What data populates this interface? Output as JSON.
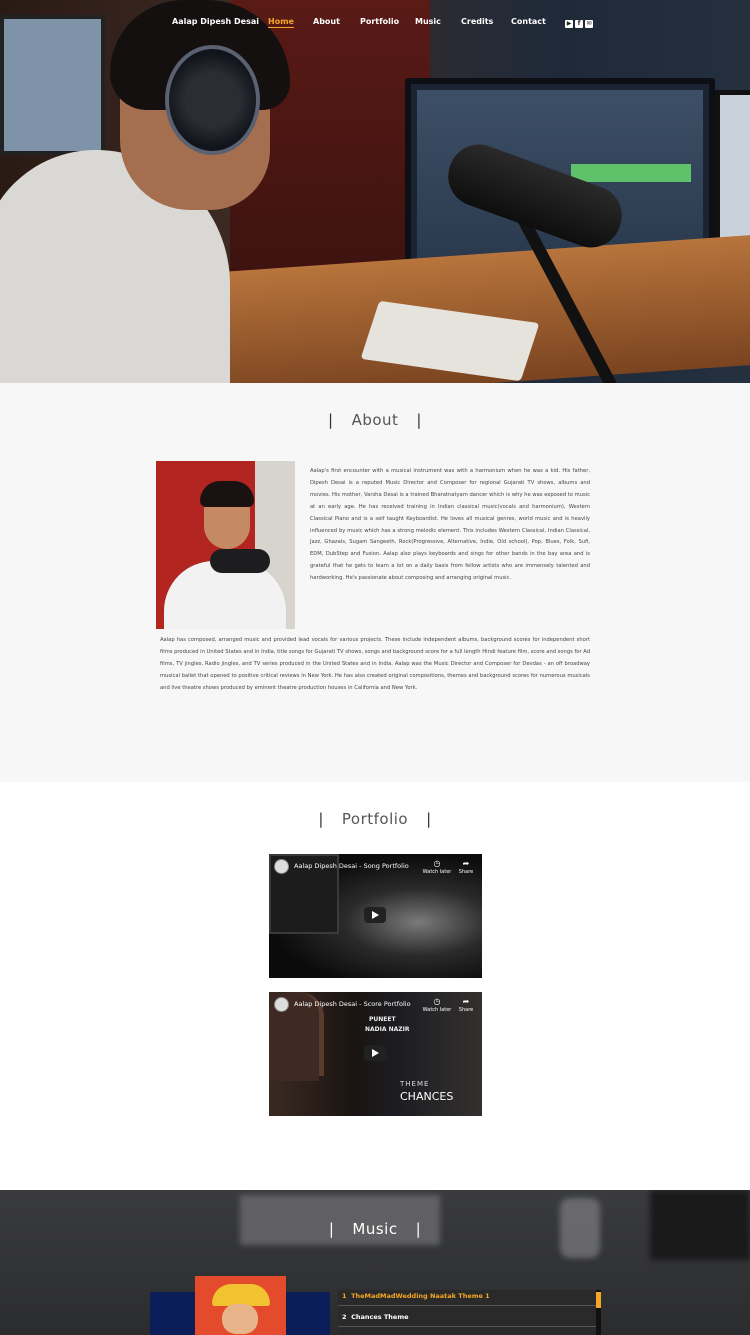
{
  "nav": {
    "brand": "Aalap Dipesh Desai",
    "items": [
      "Home",
      "About",
      "Portfolio",
      "Music",
      "Credits",
      "Contact"
    ],
    "active": "Home",
    "social_icons": [
      "youtube-icon",
      "facebook-icon",
      "email-icon"
    ]
  },
  "about": {
    "title": "About",
    "paragraph1": "Aalap's first encounter with a musical instrument was with a harmonium when he was a kid. His father, Dipesh Desai is a reputed Music Director and Composer for regional Gujarati TV shows, albums and movies. His mother, Varsha Desai is a trained Bharatnatyam dancer which is why he was exposed to music at an early age. He has received training in Indian classical music(vocals and harmonium), Western Classical Piano and is a self taught Keyboardist. He loves all musical genres, world music and is heavily influenced by music which has a strong melodic element. This includes Western Classical, Indian Classical, Jazz, Ghazals, Sugam Sangeeth, Rock(Progressive, Alternative, Indie, Old school), Pop, Blues, Folk, Sufi, EDM, DubStep and Fusion. Aalap also plays keyboards and sings for other bands in the bay area and is grateful that he gets to learn a lot on a daily basis from fellow artists who are immensely talented and hardworking. He's passionate about composing and arranging original music.",
    "paragraph2": "Aalap has composed, arranged music and provided lead vocals for various projects. These include independent albums, background scores for independent short films produced in United States and in India, title songs for Gujarati TV shows, songs and background score for a full length Hindi feature film, score and songs for Ad films, TV jingles, Radio jingles, and TV series produced in the United States and in India. Aalap was the Music Director and Composer for Devdas - an off broadway musical ballet that opened to positive critical reviews in New York. He has also created original compositions, themes and background scores for numerous musicals and live theatre shows produced by eminent theatre production houses in California and New York."
  },
  "portfolio": {
    "title": "Portfolio",
    "videos": [
      {
        "title": "Aalap Dipesh Desai - Song Portfolio",
        "watch_later": "Watch later",
        "share": "Share"
      },
      {
        "title": "Aalap Dipesh Desai - Score Portfolio",
        "watch_later": "Watch later",
        "share": "Share",
        "credit1": "PUNEET",
        "credit2": "NADIA NAZIR",
        "overlay_top": "THEME",
        "overlay_bottom": "CHANCES"
      }
    ]
  },
  "music": {
    "title": "Music",
    "tracks": [
      {
        "num": "1",
        "name": "TheMadMadWedding Naatak Theme 1"
      },
      {
        "num": "2",
        "name": "Chances Theme"
      }
    ]
  },
  "colors": {
    "accent": "#f5a623",
    "about_bg": "#f7f7f7",
    "music_bg": "#333436"
  }
}
